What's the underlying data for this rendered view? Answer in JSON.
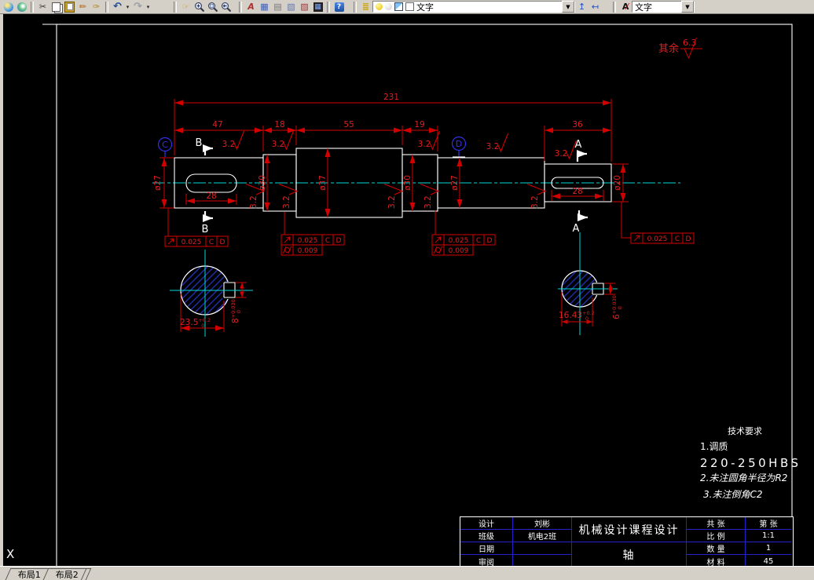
{
  "window": {
    "cursor_label": "X"
  },
  "toolbar": {
    "layer_dropdown_value": "文字",
    "style_dropdown_value": "文字"
  },
  "statusbar": {
    "tab_layout1": "布局1",
    "tab_layout2": "布局2"
  },
  "drawing": {
    "default_roughness_label": "其余",
    "default_roughness_value": "6.3",
    "roughness_value": "3.2",
    "dims": {
      "overall": "231",
      "seg1": "47",
      "seg2": "18",
      "seg3": "55",
      "seg4": "19",
      "seg6": "36",
      "key_left": "28",
      "key_right": "28"
    },
    "dias": {
      "left": "ø27",
      "sec2": "ø30",
      "sec3": "ø37",
      "sec4": "ø30",
      "sec5": "ø27",
      "right": "ø20"
    },
    "datum_c": "C",
    "datum_d": "D",
    "section_a": "A",
    "section_b": "B",
    "tolerance": {
      "runout_value": "0.025",
      "datum_ref1": "C",
      "datum_ref2": "D",
      "cylindricity_value": "0.009"
    },
    "xsec_left": {
      "width": "23.5",
      "width_tol_upper": "+0.2",
      "width_tol_lower": "0",
      "depth": "8",
      "depth_tol_upper": "+0.030",
      "depth_tol_lower": "0"
    },
    "xsec_right": {
      "width": "16.43",
      "width_tol_upper": "+0.2",
      "width_tol_lower": "0",
      "depth": "6",
      "depth_tol_upper": "+0.030",
      "depth_tol_lower": "0"
    },
    "tech_requirements": {
      "title": "技术要求",
      "line1": "1.调质",
      "line2": "220-250HBS",
      "line3": "2.未注圆角半径为R2",
      "line4": "3.未注倒角C2"
    }
  },
  "title_block": {
    "design_label": "设计",
    "design_value": "刘彬",
    "class_label": "班级",
    "class_value": "机电2班",
    "date_label": "日期",
    "date_value": "",
    "review_label": "审阅",
    "review_value": "",
    "project_title": "机械设计课程设计",
    "part_name": "轴",
    "total_sheets_label": "共  张",
    "sheet_no_label": "第  张",
    "scale_label": "比 例",
    "scale_value": "1:1",
    "quantity_label": "数 量",
    "quantity_value": "1",
    "material_label": "材 料",
    "material_value": "45"
  },
  "icons": {
    "runout": "45-degree-arrow",
    "cylindricity": "circle-with-slashes",
    "roughness": "check-mark"
  },
  "colors": {
    "dimension_red": "#d40000",
    "centerline_cyan": "#00d8d8",
    "datum_blue": "#3232e6",
    "outline_white": "#ffffff",
    "hatch_blue": "#2233bb",
    "table_border_blue": "#2323cc",
    "toolbar_bg": "#d4d0c8"
  }
}
